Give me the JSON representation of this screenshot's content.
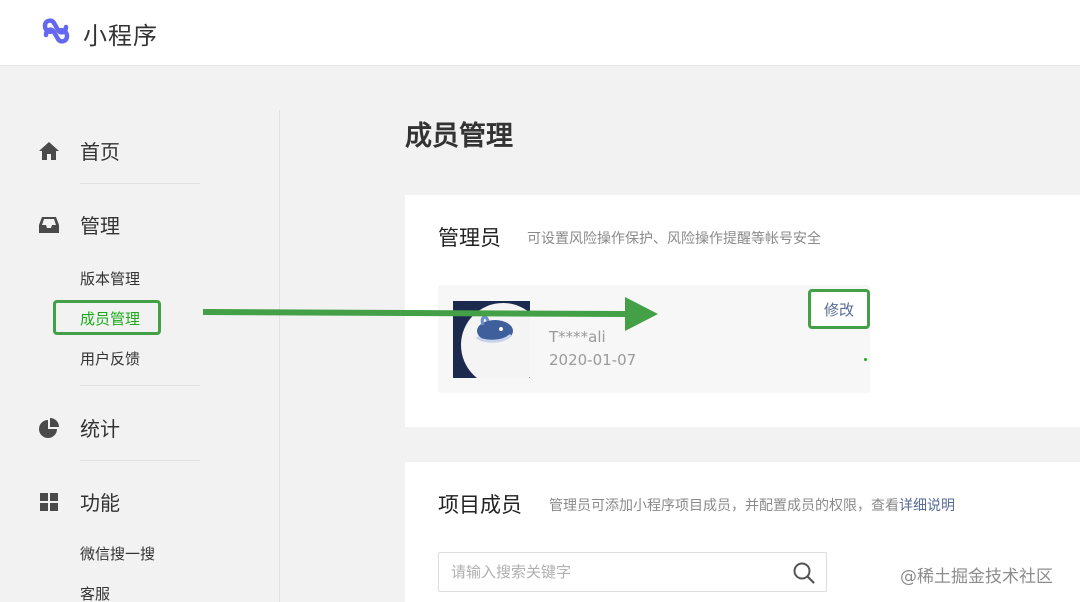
{
  "header": {
    "app_title": "小程序",
    "logo_icon": "miniprogram-logo-icon",
    "brand_color": "#6467f0"
  },
  "sidebar": {
    "home_label": "首页",
    "manage_label": "管理",
    "manage_sub": [
      "版本管理",
      "成员管理",
      "用户反馈"
    ],
    "stats_label": "统计",
    "features_label": "功能",
    "features_sub": [
      "微信搜一搜",
      "客服"
    ]
  },
  "main": {
    "page_title": "成员管理",
    "admin": {
      "title": "管理员",
      "description": "可设置风险操作保护、风险操作提醒等帐号安全",
      "member_name": "T****ali",
      "member_date": "2020-01-07",
      "edit_label": "修改"
    },
    "project": {
      "title": "项目成员",
      "description": "管理员可添加小程序项目成员，并配置成员的权限，查看",
      "link_label": "详细说明",
      "search_placeholder": "请输入搜索关键字"
    }
  },
  "watermark": "@稀土掘金技术社区",
  "colors": {
    "highlight": "#43a047",
    "link": "#576b95",
    "active": "#1aad19"
  }
}
